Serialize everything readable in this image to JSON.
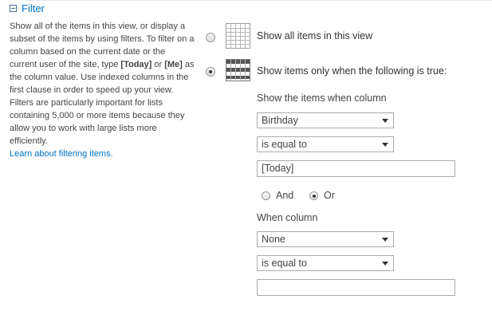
{
  "section": {
    "title": "Filter",
    "description_parts": {
      "p1": "Show all of the items in this view, or display a subset of the items by using filters. To filter on a column based on the current date or the current user of the site, type ",
      "today_token": "[Today]",
      "p2": " or ",
      "me_token": "[Me]",
      "p3": " as the column value. Use indexed columns in the first clause in order to speed up your view. Filters are particularly important for lists containing 5,000 or more items because they allow you to work with large lists more efficiently.",
      "learn_link": "Learn about filtering items."
    }
  },
  "options": {
    "show_all": {
      "label": "Show all items in this view",
      "selected": false,
      "icon": "table-grid-icon"
    },
    "show_filtered": {
      "label": "Show items only when the following is true:",
      "selected": true,
      "icon": "filtered-table-icon"
    }
  },
  "clause1": {
    "label": "Show the items when column",
    "column": "Birthday",
    "operator": "is equal to",
    "value": "[Today]"
  },
  "connector": {
    "and_label": "And",
    "or_label": "Or",
    "selected": "Or"
  },
  "clause2": {
    "label": "When column",
    "column": "None",
    "operator": "is equal to",
    "value": ""
  },
  "colors": {
    "link": "#0072c6",
    "text": "#444444",
    "border": "#ababab"
  }
}
